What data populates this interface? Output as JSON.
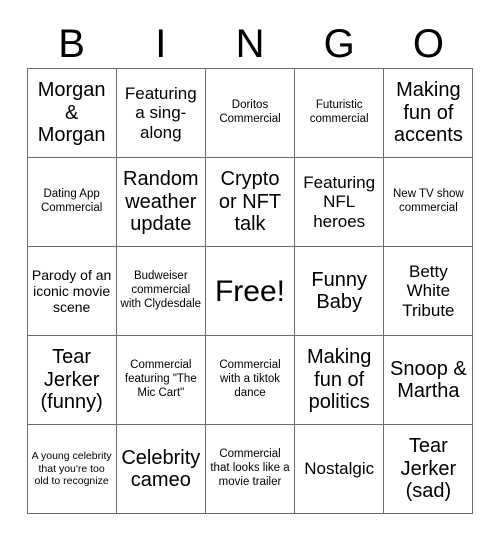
{
  "header": {
    "letters": [
      "B",
      "I",
      "N",
      "G",
      "O"
    ]
  },
  "grid": {
    "rows": 5,
    "columns": 5,
    "free_space": {
      "row": 2,
      "column": 2,
      "label": "Free!"
    },
    "cells": [
      [
        {
          "text": "Morgan & Morgan",
          "size": "lg"
        },
        {
          "text": "Featuring a sing-along",
          "size": "md"
        },
        {
          "text": "Doritos Commercial",
          "size": "xs"
        },
        {
          "text": "Futuristic commercial",
          "size": "xs"
        },
        {
          "text": "Making fun of accents",
          "size": "lg"
        }
      ],
      [
        {
          "text": "Dating App Commercial",
          "size": "xs"
        },
        {
          "text": "Random weather update",
          "size": "lg"
        },
        {
          "text": "Crypto or NFT talk",
          "size": "lg"
        },
        {
          "text": "Featuring NFL heroes",
          "size": "md"
        },
        {
          "text": "New TV show commercial",
          "size": "xs"
        }
      ],
      [
        {
          "text": "Parody of an iconic movie scene",
          "size": "sm"
        },
        {
          "text": "Budweiser commercial with Clydesdale",
          "size": "xs"
        },
        {
          "text": "Free!",
          "size": "xl"
        },
        {
          "text": "Funny Baby",
          "size": "lg"
        },
        {
          "text": "Betty White Tribute",
          "size": "md"
        }
      ],
      [
        {
          "text": "Tear Jerker (funny)",
          "size": "lg"
        },
        {
          "text": "Commercial featuring \"The Mic Cart\"",
          "size": "xs"
        },
        {
          "text": "Commercial with a tiktok dance",
          "size": "xs"
        },
        {
          "text": "Making fun of politics",
          "size": "lg"
        },
        {
          "text": "Snoop & Martha",
          "size": "lg"
        }
      ],
      [
        {
          "text": "A young celebrity that you're too old to recognize",
          "size": "xxs"
        },
        {
          "text": "Celebrity cameo",
          "size": "lg"
        },
        {
          "text": "Commercial that looks like a movie trailer",
          "size": "xs"
        },
        {
          "text": "Nostalgic",
          "size": "md"
        },
        {
          "text": "Tear Jerker (sad)",
          "size": "lg"
        }
      ]
    ]
  },
  "colors": {
    "background": "#ffffff",
    "text": "#000000",
    "border": "#6b6b6b"
  }
}
